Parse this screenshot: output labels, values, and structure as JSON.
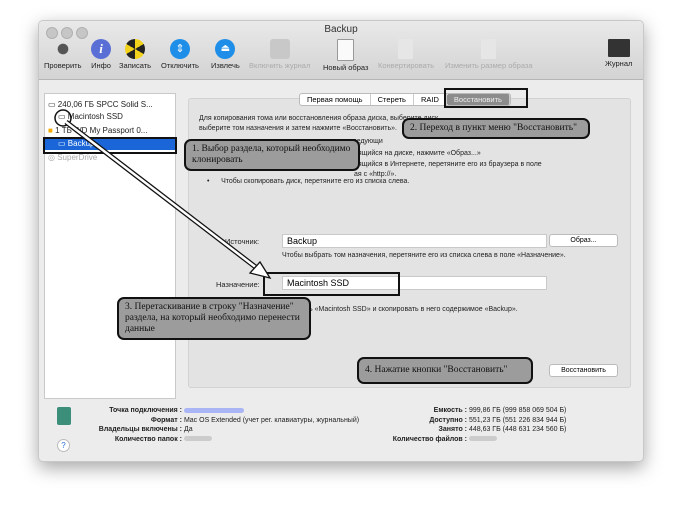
{
  "window": {
    "title": "Backup"
  },
  "toolbar": [
    {
      "label": "Проверить",
      "icon": "microscope-icon",
      "enabled": true
    },
    {
      "label": "Инфо",
      "icon": "info-icon",
      "enabled": true
    },
    {
      "label": "Записать",
      "icon": "burn-icon",
      "enabled": true
    },
    {
      "label": "Отключить",
      "icon": "unmount-icon",
      "enabled": true
    },
    {
      "label": "Извлечь",
      "icon": "eject-icon",
      "enabled": true
    },
    {
      "label": "Включить журнал",
      "icon": "journal-disk-icon",
      "enabled": false
    },
    {
      "label": "Новый образ",
      "icon": "new-image-icon",
      "enabled": true
    },
    {
      "label": "Конвертировать",
      "icon": "convert-icon",
      "enabled": false
    },
    {
      "label": "Изменить размер образа",
      "icon": "resize-image-icon",
      "enabled": false
    },
    {
      "label": "Журнал",
      "icon": "log-icon",
      "enabled": true
    }
  ],
  "sidebar": {
    "items": [
      {
        "label": "240,06 ГБ SPCC Solid S..."
      },
      {
        "label": "Macintosh SSD"
      },
      {
        "label": "1 ТБ WD My Passport 0..."
      },
      {
        "label": "Backup",
        "selected": true
      },
      {
        "label": "SuperDrive"
      }
    ]
  },
  "tabs": [
    {
      "label": "Первая помощь"
    },
    {
      "label": "Стереть"
    },
    {
      "label": "RAID"
    },
    {
      "label": "Восстановить",
      "active": true
    }
  ],
  "main": {
    "instructions": [
      "Для копирования тома или восстановления образа диска, выберите диск, ",
      "выберите том назначения и затем нажмите «Восстановить».",
      "следующи",
      "нящийся на диске, нажмите «Образ...»",
      "нящийся в Интернете, перетяните его из браузера в поле",
      "ая с «http://».",
      "Чтобы скопировать диск, перетяните его из списка слева."
    ],
    "source_label": "Источник:",
    "source_value": "Backup",
    "image_button": "Образ...",
    "source_hint": "Чтобы выбрать том назначения, перетяните его из списка слева в поле «Назначение».",
    "destination_label": "Назначение:",
    "destination_value": "Macintosh SSD",
    "erase_hint": "ь «Macintosh SSD» и скопировать в него содержимое «Backup».",
    "restore_button": "Восстановить"
  },
  "info": {
    "mount_label": "Точка подключения :",
    "format_label": "Формат :",
    "format_value": "Mac OS Extended (учет рег. клавиатуры, журнальный)",
    "owners_label": "Владельцы включены :",
    "owners_value": "Да",
    "folders_label": "Количество папок :",
    "capacity_label": "Емкость :",
    "capacity_value": "999,86 ГБ (999 858 069 504 Б)",
    "available_label": "Доступно :",
    "available_value": "551,23 ГБ (551 226 834 944 Б)",
    "used_label": "Занято :",
    "used_value": "448,63 ГБ (448 631 234 560 Б)",
    "files_label": "Количество файлов :"
  },
  "callouts": [
    "1. Выбор раздела, который необходимо клонировать",
    "2. Переход в пункт меню \"Восстановить\"",
    "3. Перетаскивание в строку \"Назначение\" раздела, на который необходимо перенести данные",
    "4. Нажатие кнопки \"Восстановить\""
  ]
}
